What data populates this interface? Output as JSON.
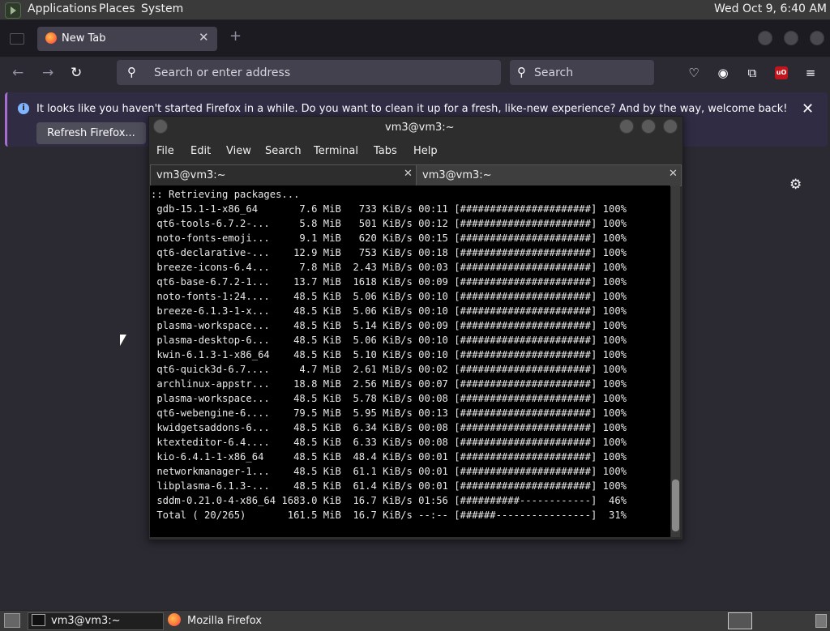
{
  "top_panel": {
    "menus": [
      "Applications",
      "Places",
      "System"
    ],
    "clock": "Wed Oct  9,  6:40 AM"
  },
  "firefox": {
    "tab_title": "New Tab",
    "urlbar_placeholder": "Search or enter address",
    "searchbar_placeholder": "Search",
    "notification_text": "It looks like you haven't started Firefox in a while. Do you want to clean it up for a fresh, like-new experience? And by the way, welcome back!",
    "refresh_button": "Refresh Firefox...",
    "ublock_badge": "uO"
  },
  "terminal": {
    "title": "vm3@vm3:~",
    "menu": [
      "File",
      "Edit",
      "View",
      "Search",
      "Terminal",
      "Tabs",
      "Help"
    ],
    "tabs": [
      "vm3@vm3:~",
      "vm3@vm3:~"
    ],
    "output": ":: Retrieving packages...\n gdb-15.1-1-x86_64       7.6 MiB   733 KiB/s 00:11 [######################] 100%\n qt6-tools-6.7.2-...     5.8 MiB   501 KiB/s 00:12 [######################] 100%\n noto-fonts-emoji...     9.1 MiB   620 KiB/s 00:15 [######################] 100%\n qt6-declarative-...    12.9 MiB   753 KiB/s 00:18 [######################] 100%\n breeze-icons-6.4...     7.8 MiB  2.43 MiB/s 00:03 [######################] 100%\n qt6-base-6.7.2-1...    13.7 MiB  1618 KiB/s 00:09 [######################] 100%\n noto-fonts-1:24....    48.5 KiB  5.06 KiB/s 00:10 [######################] 100%\n breeze-6.1.3-1-x...    48.5 KiB  5.06 KiB/s 00:10 [######################] 100%\n plasma-workspace...    48.5 KiB  5.14 KiB/s 00:09 [######################] 100%\n plasma-desktop-6...    48.5 KiB  5.06 KiB/s 00:10 [######################] 100%\n kwin-6.1.3-1-x86_64    48.5 KiB  5.10 KiB/s 00:10 [######################] 100%\n qt6-quick3d-6.7....     4.7 MiB  2.61 MiB/s 00:02 [######################] 100%\n archlinux-appstr...    18.8 MiB  2.56 MiB/s 00:07 [######################] 100%\n plasma-workspace...    48.5 KiB  5.78 KiB/s 00:08 [######################] 100%\n qt6-webengine-6....    79.5 MiB  5.95 MiB/s 00:13 [######################] 100%\n kwidgetsaddons-6...    48.5 KiB  6.34 KiB/s 00:08 [######################] 100%\n ktexteditor-6.4....    48.5 KiB  6.33 KiB/s 00:08 [######################] 100%\n kio-6.4.1-1-x86_64     48.5 KiB  48.4 KiB/s 00:01 [######################] 100%\n networkmanager-1...    48.5 KiB  61.1 KiB/s 00:01 [######################] 100%\n libplasma-6.1.3-...    48.5 KiB  61.4 KiB/s 00:01 [######################] 100%\n sddm-0.21.0-4-x86_64 1683.0 KiB  16.7 KiB/s 01:56 [##########------------]  46%\n Total ( 20/265)       161.5 MiB  16.7 KiB/s --:-- [######----------------]  31%"
  },
  "taskbar": {
    "items": [
      "vm3@vm3:~",
      "Mozilla Firefox"
    ]
  }
}
